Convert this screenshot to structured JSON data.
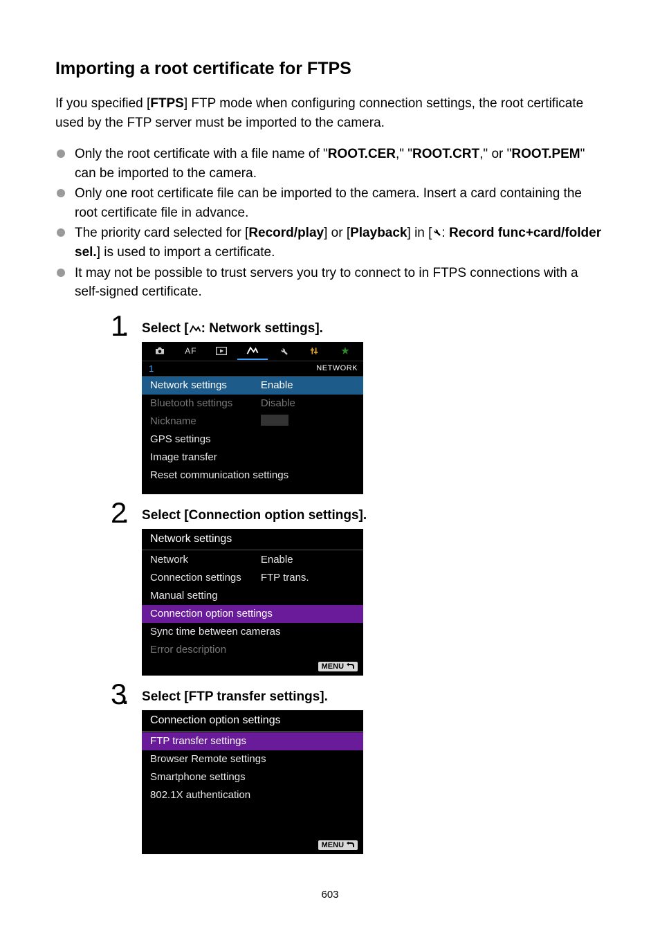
{
  "heading": "Importing a root certificate for FTPS",
  "intro_before_bold": "If you specified [",
  "intro_bold": "FTPS",
  "intro_after_bold": "] FTP mode when configuring connection settings, the root certificate used by the FTP server must be imported to the camera.",
  "bullets": {
    "b1": {
      "t1": "Only the root certificate with a file name of \"",
      "b1": "ROOT.CER",
      "t2": ",\" \"",
      "b2": "ROOT.CRT",
      "t3": ",\" or \"",
      "b3": "ROOT.PEM",
      "t4": "\" can be imported to the camera."
    },
    "b2": "Only one root certificate file can be imported to the camera. Insert a card containing the root certificate file in advance.",
    "b3": {
      "t1": "The priority card selected for [",
      "b1": "Record/play",
      "t2": "] or [",
      "b2": "Playback",
      "t3": "] in [",
      "t4": ": ",
      "b3": "Record func+card/folder sel.",
      "t5": "] is used to import a certificate."
    },
    "b4": "It may not be possible to trust servers you try to connect to in FTPS connections with a self-signed certificate."
  },
  "step1": {
    "num": "1",
    "title_before": "Select [",
    "title_after": ": Network settings].",
    "subtab_page": "1",
    "subtab_label": "NETWORK",
    "rows": {
      "r1": {
        "label": "Network settings",
        "value": "Enable"
      },
      "r2": {
        "label": "Bluetooth settings",
        "value": "Disable"
      },
      "r3": {
        "label": "Nickname"
      },
      "r4": {
        "label": "GPS settings"
      },
      "r5": {
        "label": "Image transfer"
      },
      "r6": {
        "label": "Reset communication settings"
      }
    }
  },
  "step2": {
    "num": "2",
    "title": "Select [Connection option settings].",
    "header": "Network settings",
    "rows": {
      "r1": {
        "label": "Network",
        "value": "Enable"
      },
      "r2": {
        "label": "Connection settings",
        "value": "FTP trans."
      },
      "r3": {
        "label": "Manual setting"
      },
      "r4": {
        "label": "Connection option settings"
      },
      "r5": {
        "label": "Sync time between cameras"
      },
      "r6": {
        "label": "Error description"
      }
    },
    "menu": "MENU"
  },
  "step3": {
    "num": "3",
    "title": "Select [FTP transfer settings].",
    "header": "Connection option settings",
    "rows": {
      "r1": {
        "label": "FTP transfer settings"
      },
      "r2": {
        "label": "Browser Remote settings"
      },
      "r3": {
        "label": "Smartphone settings"
      },
      "r4": {
        "label": "802.1X authentication"
      }
    },
    "menu": "MENU"
  },
  "page_number": "603"
}
